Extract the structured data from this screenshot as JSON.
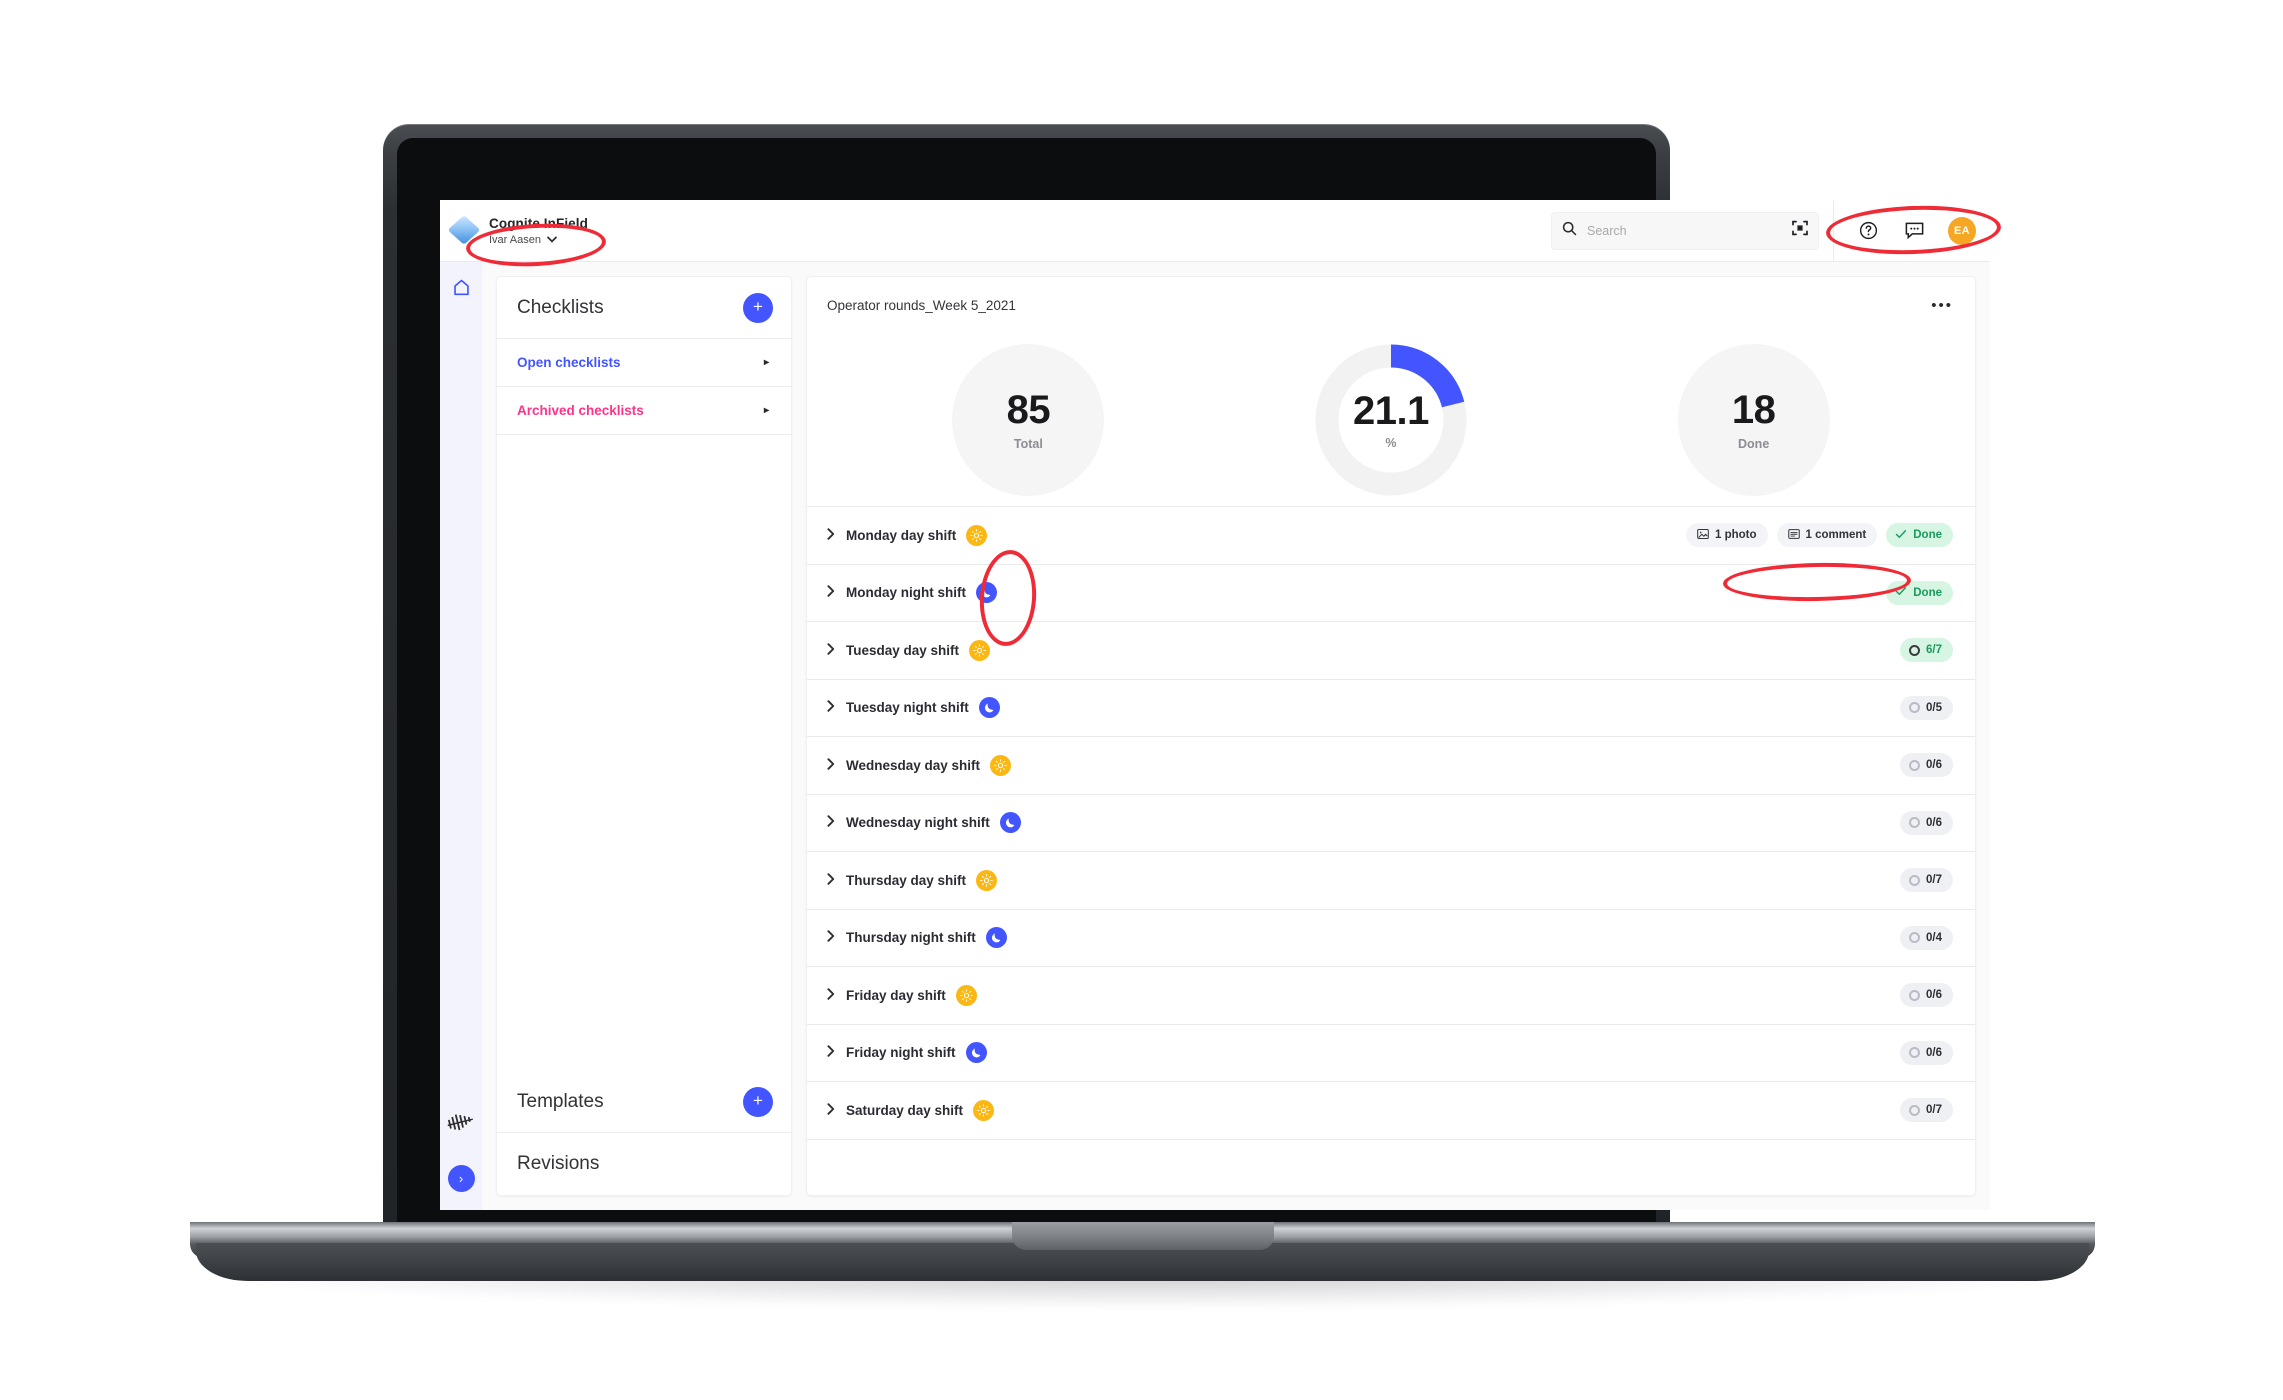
{
  "app": {
    "brand_title": "Cognite InField",
    "user_name": "Ivar Aasen",
    "user_chevron": "⌄",
    "avatar_initials": "EA"
  },
  "search": {
    "placeholder": "Search",
    "value": ""
  },
  "colors": {
    "accent_blue": "#4255ff",
    "archived_pink": "#ff3388",
    "day_shift_yellow": "#fbb713",
    "night_shift_blue": "#4255ff",
    "done_green": "#1c9a5d",
    "done_green_bg": "#d7f5e3",
    "avatar_orange": "#f5a623",
    "annotation_red": "#ee2b36"
  },
  "sidebar": {
    "home_icon": "home-icon",
    "logo_icon": "cognite-logo-icon",
    "expand_label": "›"
  },
  "checklists_panel": {
    "title": "Checklists",
    "add_label": "+",
    "items": [
      {
        "label": "Open checklists",
        "arrow": "▸",
        "state": "open"
      },
      {
        "label": "Archived checklists",
        "arrow": "▸",
        "state": "archived"
      }
    ]
  },
  "templates_panel": {
    "title": "Templates",
    "add_label": "+"
  },
  "revisions_panel": {
    "title": "Revisions"
  },
  "main": {
    "title": "Operator rounds_Week 5_2021",
    "more_label": "•••",
    "stats": {
      "total": {
        "value": "85",
        "label": "Total"
      },
      "percent": {
        "value": "21.1",
        "label": "%",
        "progress": 21.1
      },
      "done": {
        "value": "18",
        "label": "Done"
      }
    },
    "rows": [
      {
        "label": "Monday day shift",
        "shift": "day",
        "chevron": "❯",
        "meta": [
          {
            "icon": "photo-icon",
            "text": "1 photo"
          },
          {
            "icon": "comment-icon",
            "text": "1 comment"
          }
        ],
        "status": {
          "kind": "done",
          "text": "Done"
        }
      },
      {
        "label": "Monday night shift",
        "shift": "night",
        "chevron": "❯",
        "meta": [],
        "status": {
          "kind": "done",
          "text": "Done"
        }
      },
      {
        "label": "Tuesday day shift",
        "shift": "day",
        "chevron": "❯",
        "meta": [],
        "status": {
          "kind": "progress-green",
          "text": "6/7"
        }
      },
      {
        "label": "Tuesday night shift",
        "shift": "night",
        "chevron": "❯",
        "meta": [],
        "status": {
          "kind": "progress-gray",
          "text": "0/5"
        }
      },
      {
        "label": "Wednesday day shift",
        "shift": "day",
        "chevron": "❯",
        "meta": [],
        "status": {
          "kind": "progress-gray",
          "text": "0/6"
        }
      },
      {
        "label": "Wednesday night shift",
        "shift": "night",
        "chevron": "❯",
        "meta": [],
        "status": {
          "kind": "progress-gray",
          "text": "0/6"
        }
      },
      {
        "label": "Thursday day shift",
        "shift": "day",
        "chevron": "❯",
        "meta": [],
        "status": {
          "kind": "progress-gray",
          "text": "0/7"
        }
      },
      {
        "label": "Thursday night shift",
        "shift": "night",
        "chevron": "❯",
        "meta": [],
        "status": {
          "kind": "progress-gray",
          "text": "0/4"
        }
      },
      {
        "label": "Friday day shift",
        "shift": "day",
        "chevron": "❯",
        "meta": [],
        "status": {
          "kind": "progress-gray",
          "text": "0/6"
        }
      },
      {
        "label": "Friday night shift",
        "shift": "night",
        "chevron": "❯",
        "meta": [],
        "status": {
          "kind": "progress-gray",
          "text": "0/6"
        }
      },
      {
        "label": "Saturday day shift",
        "shift": "day",
        "chevron": "❯",
        "meta": [],
        "status": {
          "kind": "progress-gray",
          "text": "0/7"
        }
      }
    ]
  },
  "annotations": [
    {
      "name": "user-dropdown-highlight",
      "shape": "ellipse"
    },
    {
      "name": "topbar-actions-highlight",
      "shape": "ellipse"
    },
    {
      "name": "shift-icons-highlight",
      "shape": "ellipse"
    },
    {
      "name": "row-meta-badges-highlight",
      "shape": "ellipse"
    }
  ]
}
